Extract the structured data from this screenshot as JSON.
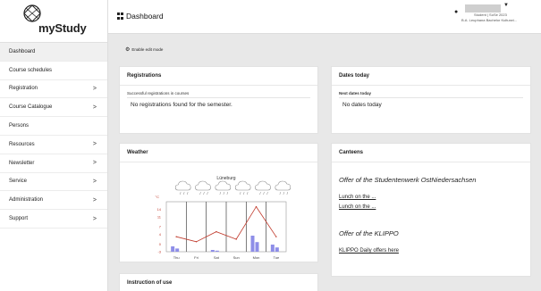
{
  "app": {
    "name": "myStudy",
    "logo_icon": "mystudy-logo-icon"
  },
  "sidebar": {
    "items": [
      {
        "label": "Dashboard",
        "has_children": false,
        "active": true
      },
      {
        "label": "Course schedules",
        "has_children": false
      },
      {
        "label": "Registration",
        "has_children": true
      },
      {
        "label": "Course Catalogue",
        "has_children": true
      },
      {
        "label": "Persons",
        "has_children": false
      },
      {
        "label": "Resources",
        "has_children": true
      },
      {
        "label": "Newsletter",
        "has_children": true
      },
      {
        "label": "Service",
        "has_children": true
      },
      {
        "label": "Administration",
        "has_children": true
      },
      {
        "label": "Support",
        "has_children": true
      }
    ],
    "chevron": ">"
  },
  "header": {
    "title": "Dashboard",
    "title_icon": "grid-icon",
    "user": {
      "role": "Student | SoSe 2023",
      "program": "B.A. Leuphana Bachelor Kulturwi..."
    }
  },
  "edit_mode": {
    "label": "Enable edit mode",
    "icon": "gear-icon"
  },
  "cards": {
    "registrations": {
      "title": "Registrations",
      "subtitle": "Successful registrations in courses",
      "message": "No registrations found for the semester."
    },
    "dates": {
      "title": "Dates today",
      "subtitle": "Next dates today",
      "message": "No dates today"
    },
    "weather": {
      "title": "Weather"
    },
    "canteens": {
      "title": "Canteens",
      "studentenwerk_title": "Offer of the Studentenwerk OstNiedersachsen",
      "links": [
        "Lunch on the ...",
        "Lunch on the ..."
      ],
      "klippo_title": "Offer of the KLIPPO",
      "klippo_link": "KLIPPO Daily offers here"
    },
    "instruction": {
      "title": "Instruction of use"
    }
  },
  "chart_data": {
    "type": "line",
    "title": "Lüneburg",
    "ylabel": "°C",
    "y_ticks": [
      14,
      11,
      7,
      4,
      0,
      -3
    ],
    "ylim": [
      -3,
      17
    ],
    "categories": [
      "Thu",
      "Fri",
      "Sat",
      "Sun",
      "Mon",
      "Tue"
    ],
    "series": [
      {
        "type": "line",
        "values": [
          3,
          1,
          5,
          2,
          15,
          3
        ]
      },
      {
        "type": "bar",
        "values": [
          1.5,
          0,
          0.5,
          0,
          4.5,
          2
        ]
      }
    ],
    "icon": "cloud-rain-icon",
    "colors": {
      "temperature": "#c0392b",
      "precipitation": "#8e8ee8"
    }
  }
}
